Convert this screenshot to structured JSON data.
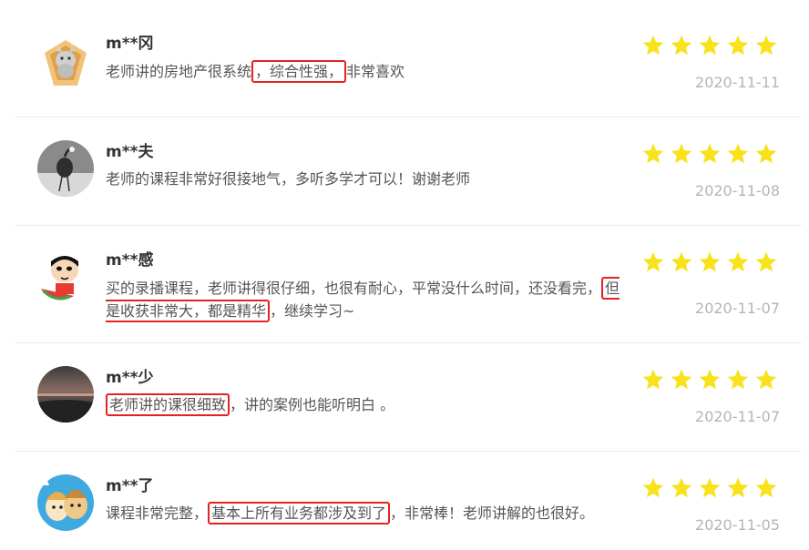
{
  "reviews": [
    {
      "user": "m**冈",
      "text_before": "老师讲的房地产很系统",
      "text_highlight": "，综合性强，",
      "text_after": "非常喜欢",
      "rating": 5,
      "date": "2020-11-11"
    },
    {
      "user": "m**夫",
      "text_before": "老师的课程非常好很接地气，多听多学才可以！谢谢老师",
      "text_highlight": "",
      "text_after": "",
      "rating": 5,
      "date": "2020-11-08"
    },
    {
      "user": "m**感",
      "text_before": "买的录播课程，老师讲得很仔细，也很有耐心，平常没什么时间，还没看完，",
      "text_highlight": "但是收获非常大，都是精华",
      "text_after": "，继续学习~",
      "rating": 5,
      "date": "2020-11-07"
    },
    {
      "user": "m**少",
      "text_before": "",
      "text_highlight": "老师讲的课很细致",
      "text_after": "，讲的案例也能听明白 。",
      "rating": 5,
      "date": "2020-11-07"
    },
    {
      "user": "m**了",
      "text_before": "课程非常完整，",
      "text_highlight": "基本上所有业务都涉及到了",
      "text_after": "，非常棒！老师讲解的也很好。",
      "rating": 5,
      "date": "2020-11-05"
    }
  ],
  "colors": {
    "star": "#f7e21b",
    "highlight_border": "#e52222",
    "date": "#b5b5b5"
  }
}
